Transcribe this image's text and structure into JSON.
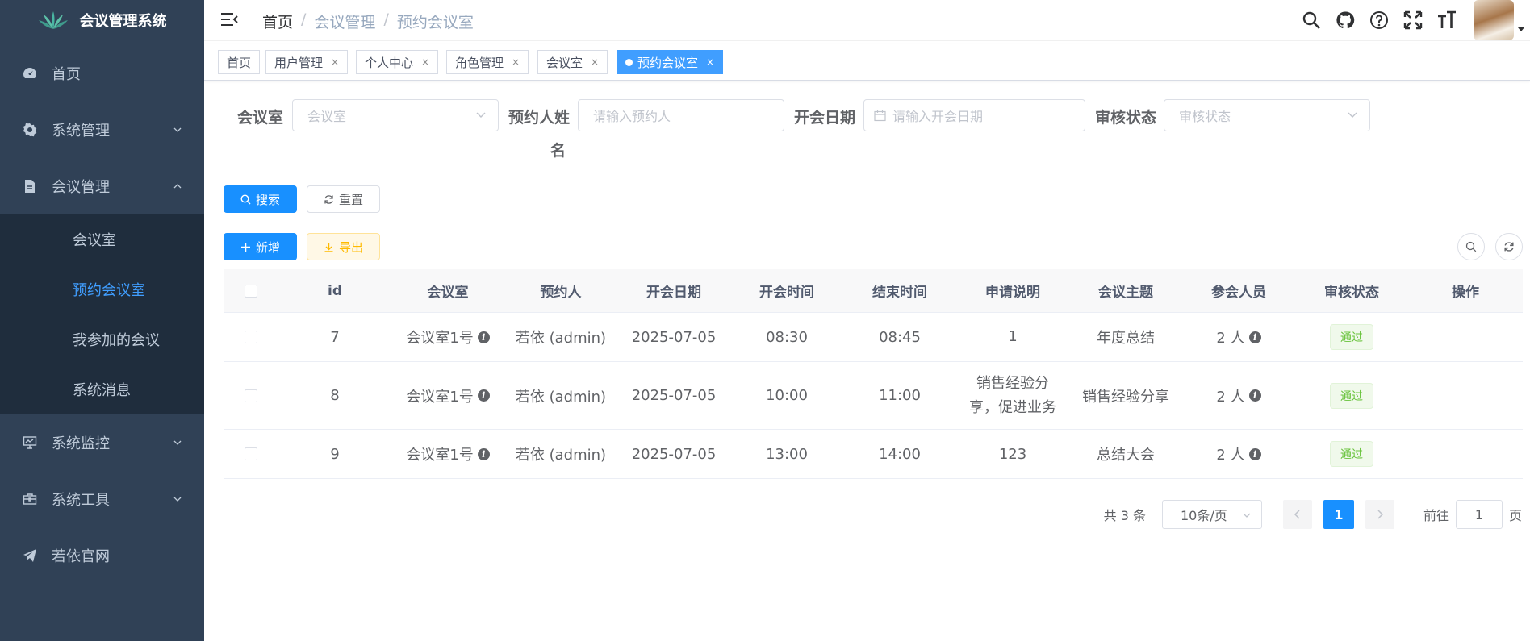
{
  "app": {
    "title": "会议管理系统"
  },
  "sidebar": {
    "items": [
      {
        "label": "首页"
      },
      {
        "label": "系统管理"
      },
      {
        "label": "会议管理"
      },
      {
        "label": "系统监控"
      },
      {
        "label": "系统工具"
      },
      {
        "label": "若依官网"
      }
    ],
    "submenu": [
      {
        "label": "会议室"
      },
      {
        "label": "预约会议室"
      },
      {
        "label": "我参加的会议"
      },
      {
        "label": "系统消息"
      }
    ]
  },
  "breadcrumb": [
    "首页",
    "会议管理",
    "预约会议室"
  ],
  "breadcrumb_separator": "/",
  "tags": [
    {
      "label": "首页"
    },
    {
      "label": "用户管理",
      "close": "×"
    },
    {
      "label": "个人中心",
      "close": "×"
    },
    {
      "label": "角色管理",
      "close": "×"
    },
    {
      "label": "会议室",
      "close": "×"
    },
    {
      "label": "预约会议室",
      "close": "×"
    }
  ],
  "search": {
    "room_label": "会议室",
    "room_placeholder": "会议室",
    "user_label_line1": "预约人姓",
    "user_label_line2": "名",
    "user_placeholder": "请输入预约人",
    "date_label": "开会日期",
    "date_placeholder": "请输入开会日期",
    "status_label": "审核状态",
    "status_placeholder": "审核状态",
    "search_btn": "搜索",
    "reset_btn": "重置"
  },
  "toolbar": {
    "add_btn": "新增",
    "export_btn": "导出"
  },
  "table": {
    "headers": [
      "id",
      "会议室",
      "预约人",
      "开会日期",
      "开会时间",
      "结束时间",
      "申请说明",
      "会议主题",
      "参会人员",
      "审核状态",
      "操作"
    ],
    "rows": [
      {
        "id": "7",
        "room": "会议室1号",
        "user": "若依 (admin)",
        "date": "2025-07-05",
        "start": "08:30",
        "end": "08:45",
        "desc_line1": "1",
        "desc_line2": "",
        "topic": "年度总结",
        "attendees": "2 人",
        "status": "通过"
      },
      {
        "id": "8",
        "room": "会议室1号",
        "user": "若依 (admin)",
        "date": "2025-07-05",
        "start": "10:00",
        "end": "11:00",
        "desc_line1": "销售经验分",
        "desc_line2": "享，促进业务",
        "topic": "销售经验分享",
        "attendees": "2 人",
        "status": "通过"
      },
      {
        "id": "9",
        "room": "会议室1号",
        "user": "若依 (admin)",
        "date": "2025-07-05",
        "start": "13:00",
        "end": "14:00",
        "desc_line1": "123",
        "desc_line2": "",
        "topic": "总结大会",
        "attendees": "2 人",
        "status": "通过"
      }
    ]
  },
  "pagination": {
    "total": "共 3 条",
    "page_size": "10条/页",
    "current": "1",
    "goto_prefix": "前往",
    "goto_value": "1",
    "goto_suffix": "页"
  },
  "colors": {
    "sidebar_bg": "#304156",
    "submenu_bg": "#1f2d3d",
    "primary": "#1890ff",
    "active_menu": "#409eff",
    "success": "#67c23a",
    "warning": "#ffba00"
  },
  "icons": [
    "logo-icon",
    "dashboard-icon",
    "gear-icon",
    "document-icon",
    "monitor-icon",
    "toolbox-icon",
    "send-icon",
    "hamburger-icon",
    "search-icon",
    "github-icon",
    "question-icon",
    "fullscreen-icon",
    "text-size-icon",
    "calendar-icon",
    "refresh-icon",
    "plus-icon",
    "download-icon",
    "info-icon"
  ]
}
